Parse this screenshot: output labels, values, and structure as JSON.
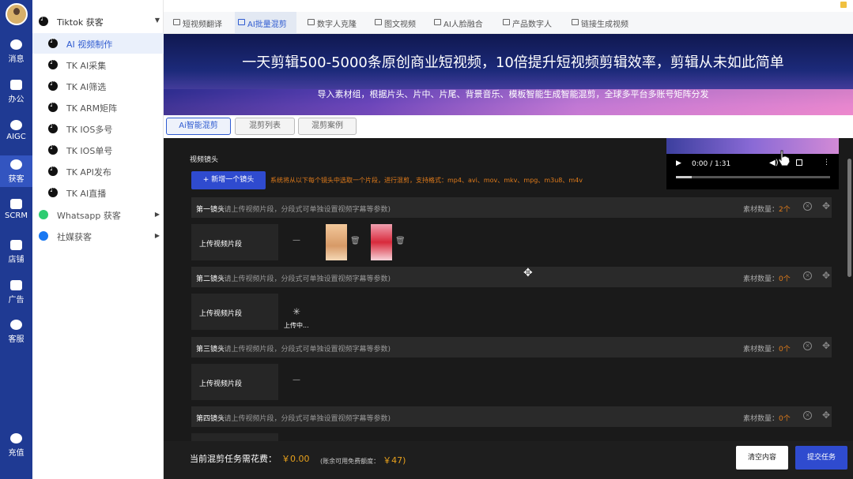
{
  "rail": {
    "items": [
      {
        "label": "消息",
        "icon": "chat-icon"
      },
      {
        "label": "办公",
        "icon": "briefcase-icon"
      },
      {
        "label": "AIGC",
        "icon": "aigc-icon"
      },
      {
        "label": "获客",
        "icon": "user-icon"
      },
      {
        "label": "SCRM",
        "icon": "chart-icon"
      },
      {
        "label": "店铺",
        "icon": "shop-icon"
      },
      {
        "label": "广告",
        "icon": "ads-icon"
      },
      {
        "label": "客服",
        "icon": "service-icon"
      },
      {
        "label": "充值",
        "icon": "yen-icon"
      }
    ]
  },
  "sidebar": {
    "group": "Tiktok 获客",
    "items": [
      {
        "label": "AI 视频制作"
      },
      {
        "label": "TK AI采集"
      },
      {
        "label": "TK AI筛选"
      },
      {
        "label": "TK ARM矩阵"
      },
      {
        "label": "TK IOS多号"
      },
      {
        "label": "TK IOS单号"
      },
      {
        "label": "TK API发布"
      },
      {
        "label": "TK AI直播"
      }
    ],
    "whatsapp": "Whatsapp 获客",
    "social": "社媒获客"
  },
  "topnav": {
    "tabs": [
      {
        "label": "短视频翻译"
      },
      {
        "label": "AI批量混剪"
      },
      {
        "label": "数字人克隆"
      },
      {
        "label": "图文视频"
      },
      {
        "label": "AI人脸融合"
      },
      {
        "label": "产品数字人"
      },
      {
        "label": "链接生成视频"
      }
    ]
  },
  "banner": {
    "headline": "一天剪辑500-5000条原创商业短视频，10倍提升短视频剪辑效率，剪辑从未如此简单",
    "subline": "导入素材组，根据片头、片中、片尾、背景音乐、模板智能生成智能混剪，全球多平台多账号矩阵分发"
  },
  "subtabs": [
    {
      "label": "Ai智能混剪"
    },
    {
      "label": "混剪列表"
    },
    {
      "label": "混剪案例"
    }
  ],
  "editor": {
    "section_title": "视频镜头",
    "add_button": "+ 新增一个镜头",
    "hint": "系统将从以下每个镜头中选取一个片段，进行混剪，支持格式：mp4、avi、mov、mkv、mpg、m3u8、m4v",
    "video_time": "0:00 / 1:31",
    "upload_label": "上传视频片段",
    "uploading": "上传中...",
    "count_label": "素材数量：",
    "shot_desc": "(请上传视频片段，分段式可单独设置视频字幕等参数)",
    "shots": [
      {
        "name": "第一镜头",
        "count": "2个"
      },
      {
        "name": "第二镜头",
        "count": "0个"
      },
      {
        "name": "第三镜头",
        "count": "0个"
      },
      {
        "name": "第四镜头",
        "count": "0个"
      }
    ]
  },
  "footer": {
    "cost_label": "当前混剪任务需花费：",
    "cost_value": "￥0.00",
    "balance_label": "(账余可用免费额度：",
    "balance_value": "￥47)",
    "clear_button": "清空内容",
    "submit_button": "提交任务"
  }
}
